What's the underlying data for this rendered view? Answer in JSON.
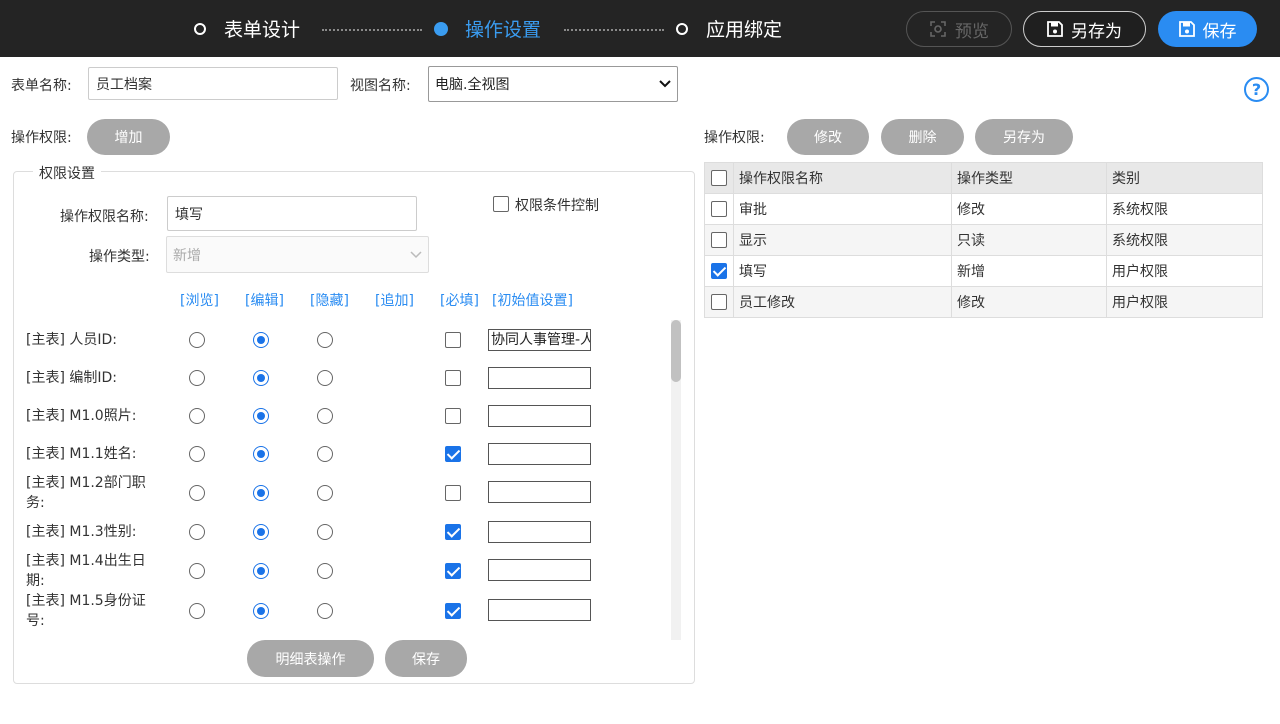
{
  "steps": [
    "表单设计",
    "操作设置",
    "应用绑定"
  ],
  "toolbar": {
    "preview": "预览",
    "save_as": "另存为",
    "save": "保存"
  },
  "form": {
    "name_label": "表单名称:",
    "name_value": "员工档案",
    "view_label": "视图名称:",
    "view_value": "电脑.全视图"
  },
  "left": {
    "perm_label": "操作权限:",
    "add_button": "增加",
    "fieldset_title": "权限设置",
    "perm_name_label": "操作权限名称:",
    "perm_name_value": "填写",
    "op_type_label": "操作类型:",
    "op_type_value": "新增",
    "condition_control": "权限条件控制",
    "columns": [
      "[浏览]",
      "[编辑]",
      "[隐藏]",
      "[追加]",
      "[必填]",
      "[初始值设置]"
    ],
    "rows": [
      {
        "label": "[主表] 人员ID:",
        "selected": "编辑",
        "required": false,
        "init": "协同人事管理-人员"
      },
      {
        "label": "[主表] 编制ID:",
        "selected": "编辑",
        "required": false,
        "init": ""
      },
      {
        "label": "[主表] M1.0照片:",
        "selected": "编辑",
        "required": false,
        "init": ""
      },
      {
        "label": "[主表] M1.1姓名:",
        "selected": "编辑",
        "required": true,
        "init": ""
      },
      {
        "label": "[主表] M1.2部门职务:",
        "selected": "编辑",
        "required": false,
        "init": ""
      },
      {
        "label": "[主表] M1.3性别:",
        "selected": "编辑",
        "required": true,
        "init": ""
      },
      {
        "label": "[主表] M1.4出生日期:",
        "selected": "编辑",
        "required": true,
        "init": ""
      },
      {
        "label": "[主表] M1.5身份证号:",
        "selected": "编辑",
        "required": true,
        "init": ""
      }
    ],
    "detail_button": "明细表操作",
    "save_button": "保存"
  },
  "right": {
    "perm_label": "操作权限:",
    "edit_button": "修改",
    "delete_button": "删除",
    "save_as_button": "另存为",
    "table_headers": [
      "操作权限名称",
      "操作类型",
      "类别"
    ],
    "table_rows": [
      {
        "name": "审批",
        "type": "修改",
        "category": "系统权限",
        "checked": false
      },
      {
        "name": "显示",
        "type": "只读",
        "category": "系统权限",
        "checked": false
      },
      {
        "name": "填写",
        "type": "新增",
        "category": "用户权限",
        "checked": true
      },
      {
        "name": "员工修改",
        "type": "修改",
        "category": "用户权限",
        "checked": false
      }
    ]
  },
  "help_icon": "?",
  "colors": {
    "accent": "#2a8cf2",
    "topbar": "#242424",
    "gray_button": "#a8a8a8"
  }
}
